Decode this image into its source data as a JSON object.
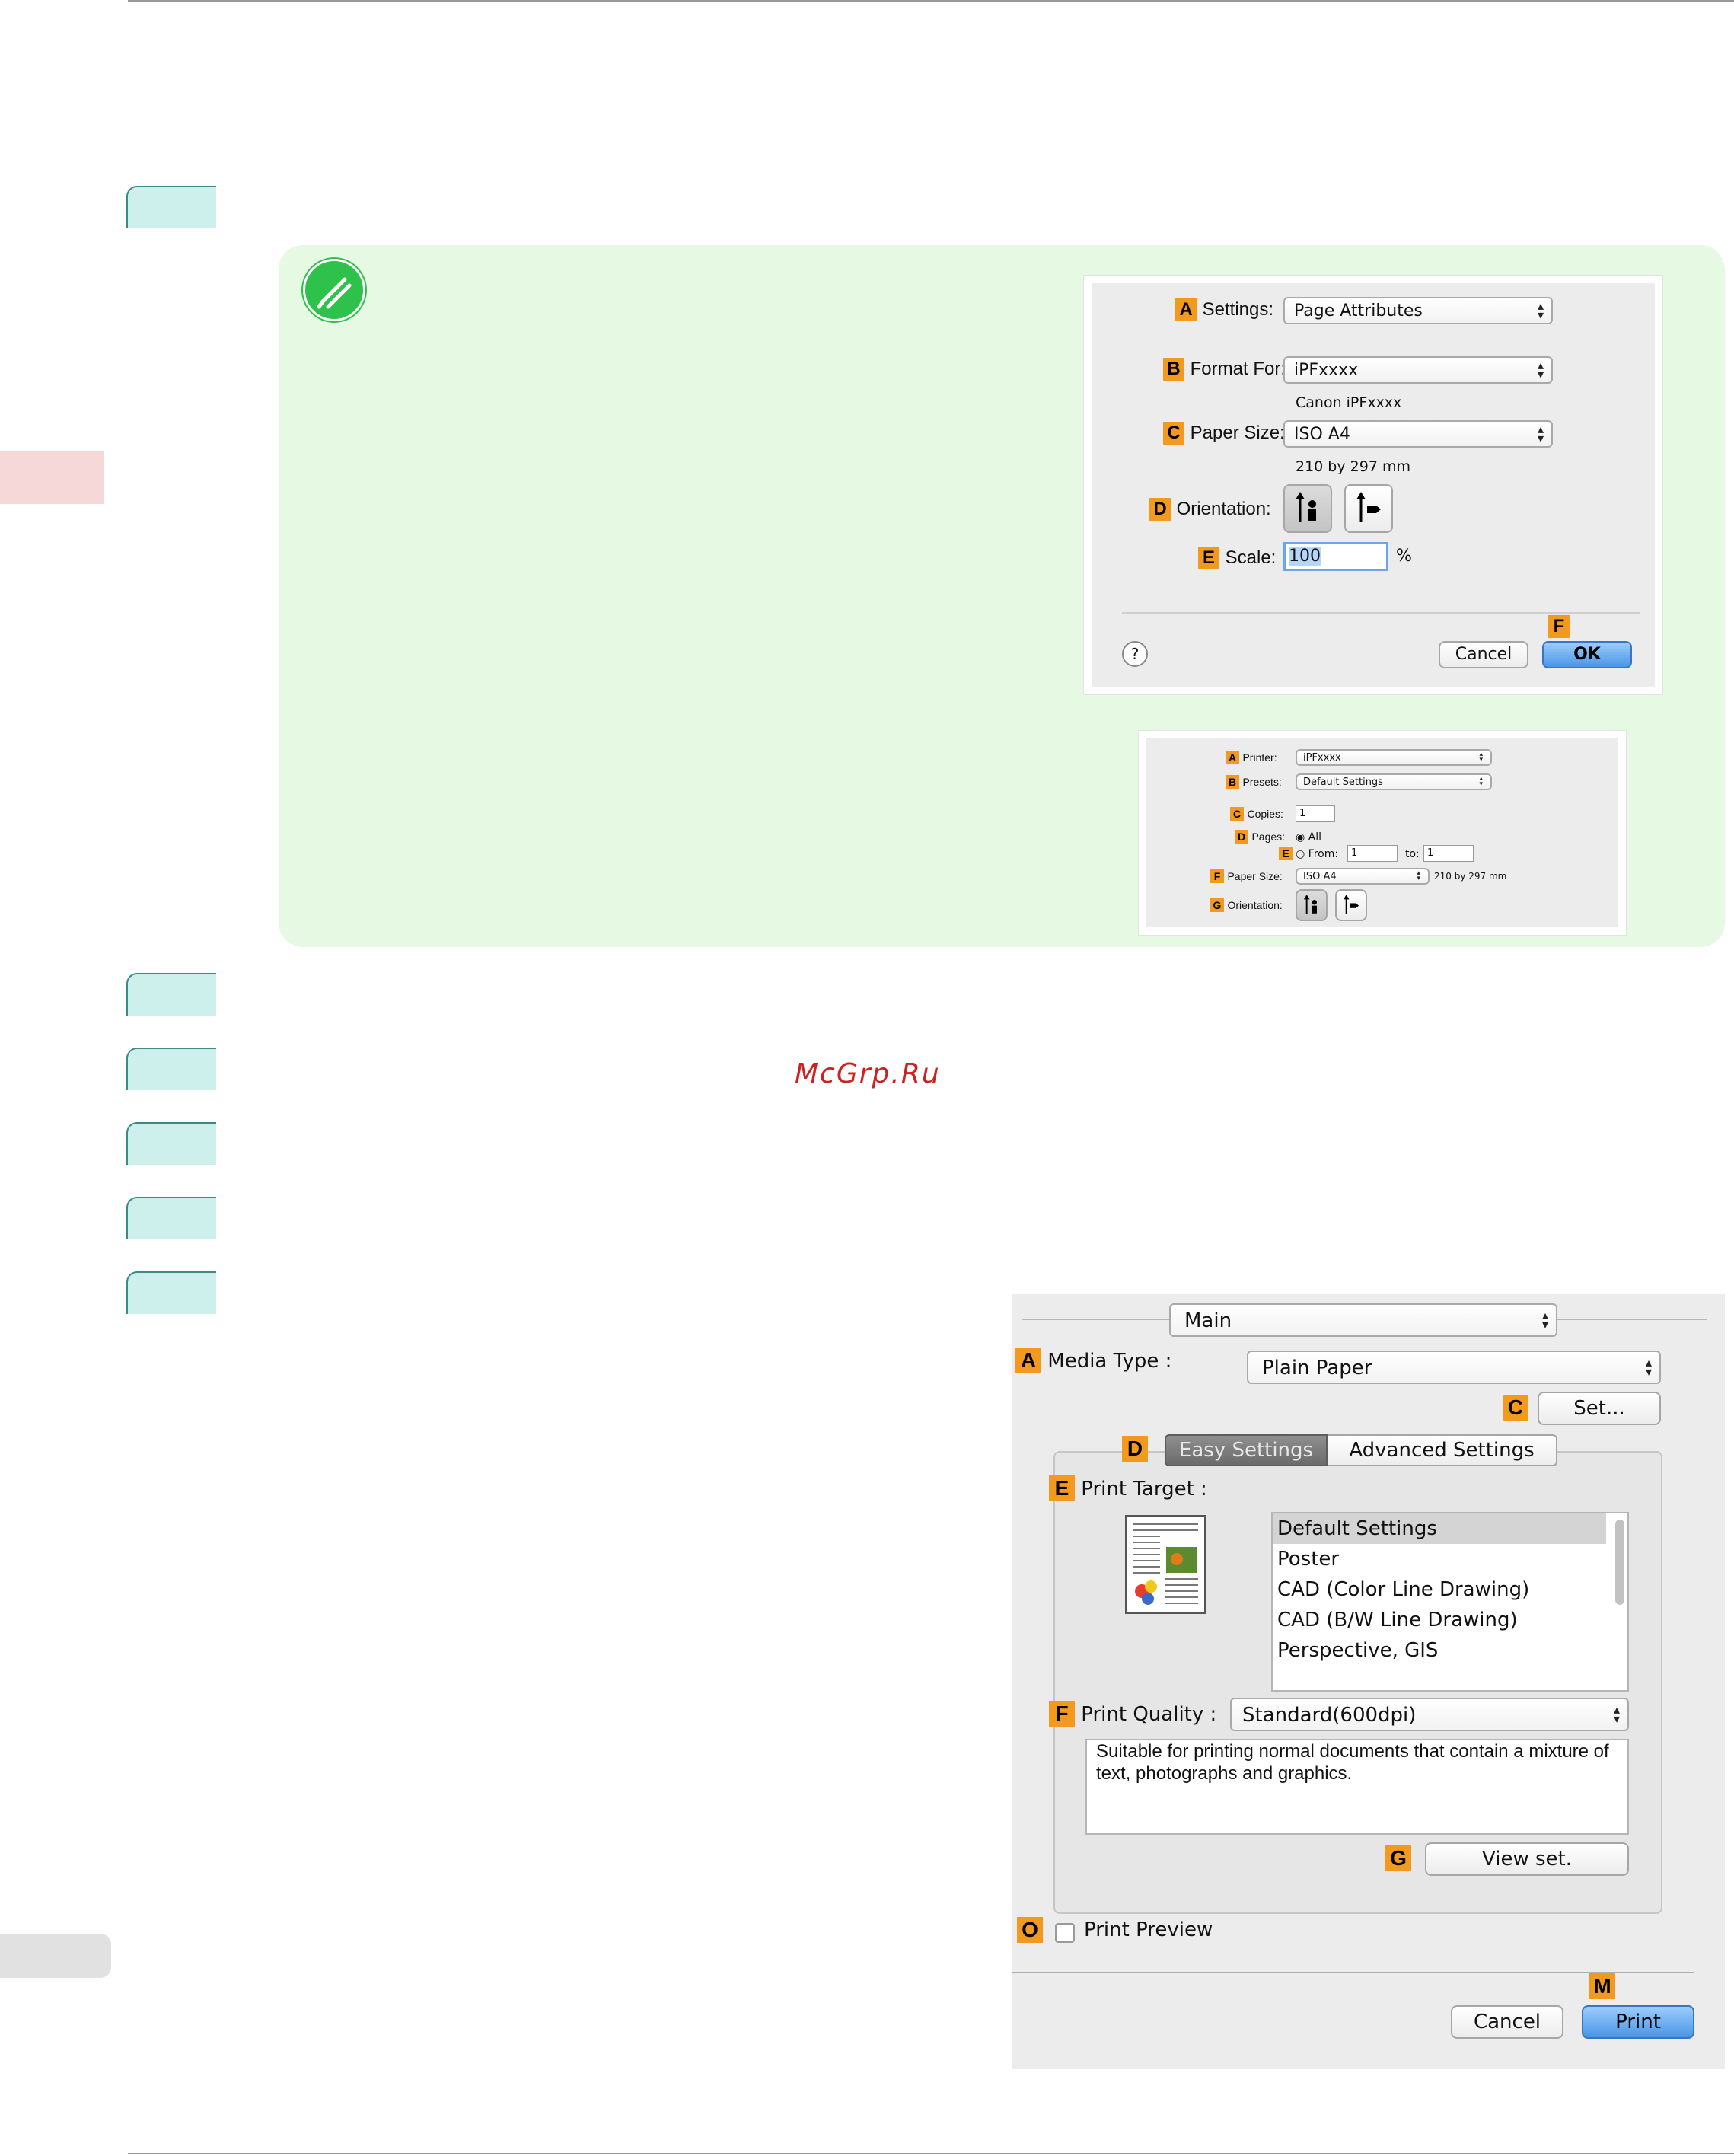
{
  "watermark": "McGrp.Ru",
  "page_attributes_dialog": {
    "settings": {
      "key": "A",
      "label": "Settings:",
      "value": "Page Attributes"
    },
    "format_for": {
      "key": "B",
      "label": "Format For:",
      "value": "iPFxxxx",
      "sub": "Canon iPFxxxx"
    },
    "paper_size": {
      "key": "C",
      "label": "Paper Size:",
      "value": "ISO A4",
      "sub": "210 by 297 mm"
    },
    "orientation": {
      "key": "D",
      "label": "Orientation:"
    },
    "scale": {
      "key": "E",
      "label": "Scale:",
      "value": "100",
      "unit": "%"
    },
    "ok_key": "F",
    "help": "?",
    "cancel": "Cancel",
    "ok": "OK"
  },
  "print_dialog_small": {
    "printer": {
      "key": "A",
      "label": "Printer:",
      "value": "iPFxxxx"
    },
    "presets": {
      "key": "B",
      "label": "Presets:",
      "value": "Default Settings"
    },
    "copies": {
      "key": "C",
      "label": "Copies:",
      "value": "1"
    },
    "pages": {
      "key": "D",
      "label": "Pages:",
      "option_all": "All"
    },
    "range": {
      "key": "E",
      "from_label": "From:",
      "from_value": "1",
      "to_label": "to:",
      "to_value": "1"
    },
    "paper_size": {
      "key": "F",
      "label": "Paper Size:",
      "value": "ISO A4",
      "sub": "210 by 297 mm"
    },
    "orientation": {
      "key": "G",
      "label": "Orientation:"
    }
  },
  "main_dialog": {
    "panel": "Main",
    "media_type": {
      "key": "A",
      "label": "Media Type :",
      "value": "Plain Paper"
    },
    "set_key": "C",
    "set_button": "Set...",
    "tabs_key": "D",
    "tabs": [
      "Easy Settings",
      "Advanced Settings"
    ],
    "print_target": {
      "key": "E",
      "label": "Print Target :",
      "items": [
        "Default Settings",
        "Poster",
        "CAD (Color Line Drawing)",
        "CAD (B/W Line Drawing)",
        "Perspective, GIS"
      ],
      "selected": "Default Settings"
    },
    "print_quality": {
      "key": "F",
      "label": "Print Quality :",
      "value": "Standard(600dpi)",
      "description": "Suitable for printing normal documents that contain a mixture of text, photographs and graphics."
    },
    "view_set_key": "G",
    "view_set_button": "View set.",
    "preview_key": "O",
    "preview_label": "Print Preview",
    "print_key": "M",
    "cancel": "Cancel",
    "print": "Print"
  }
}
